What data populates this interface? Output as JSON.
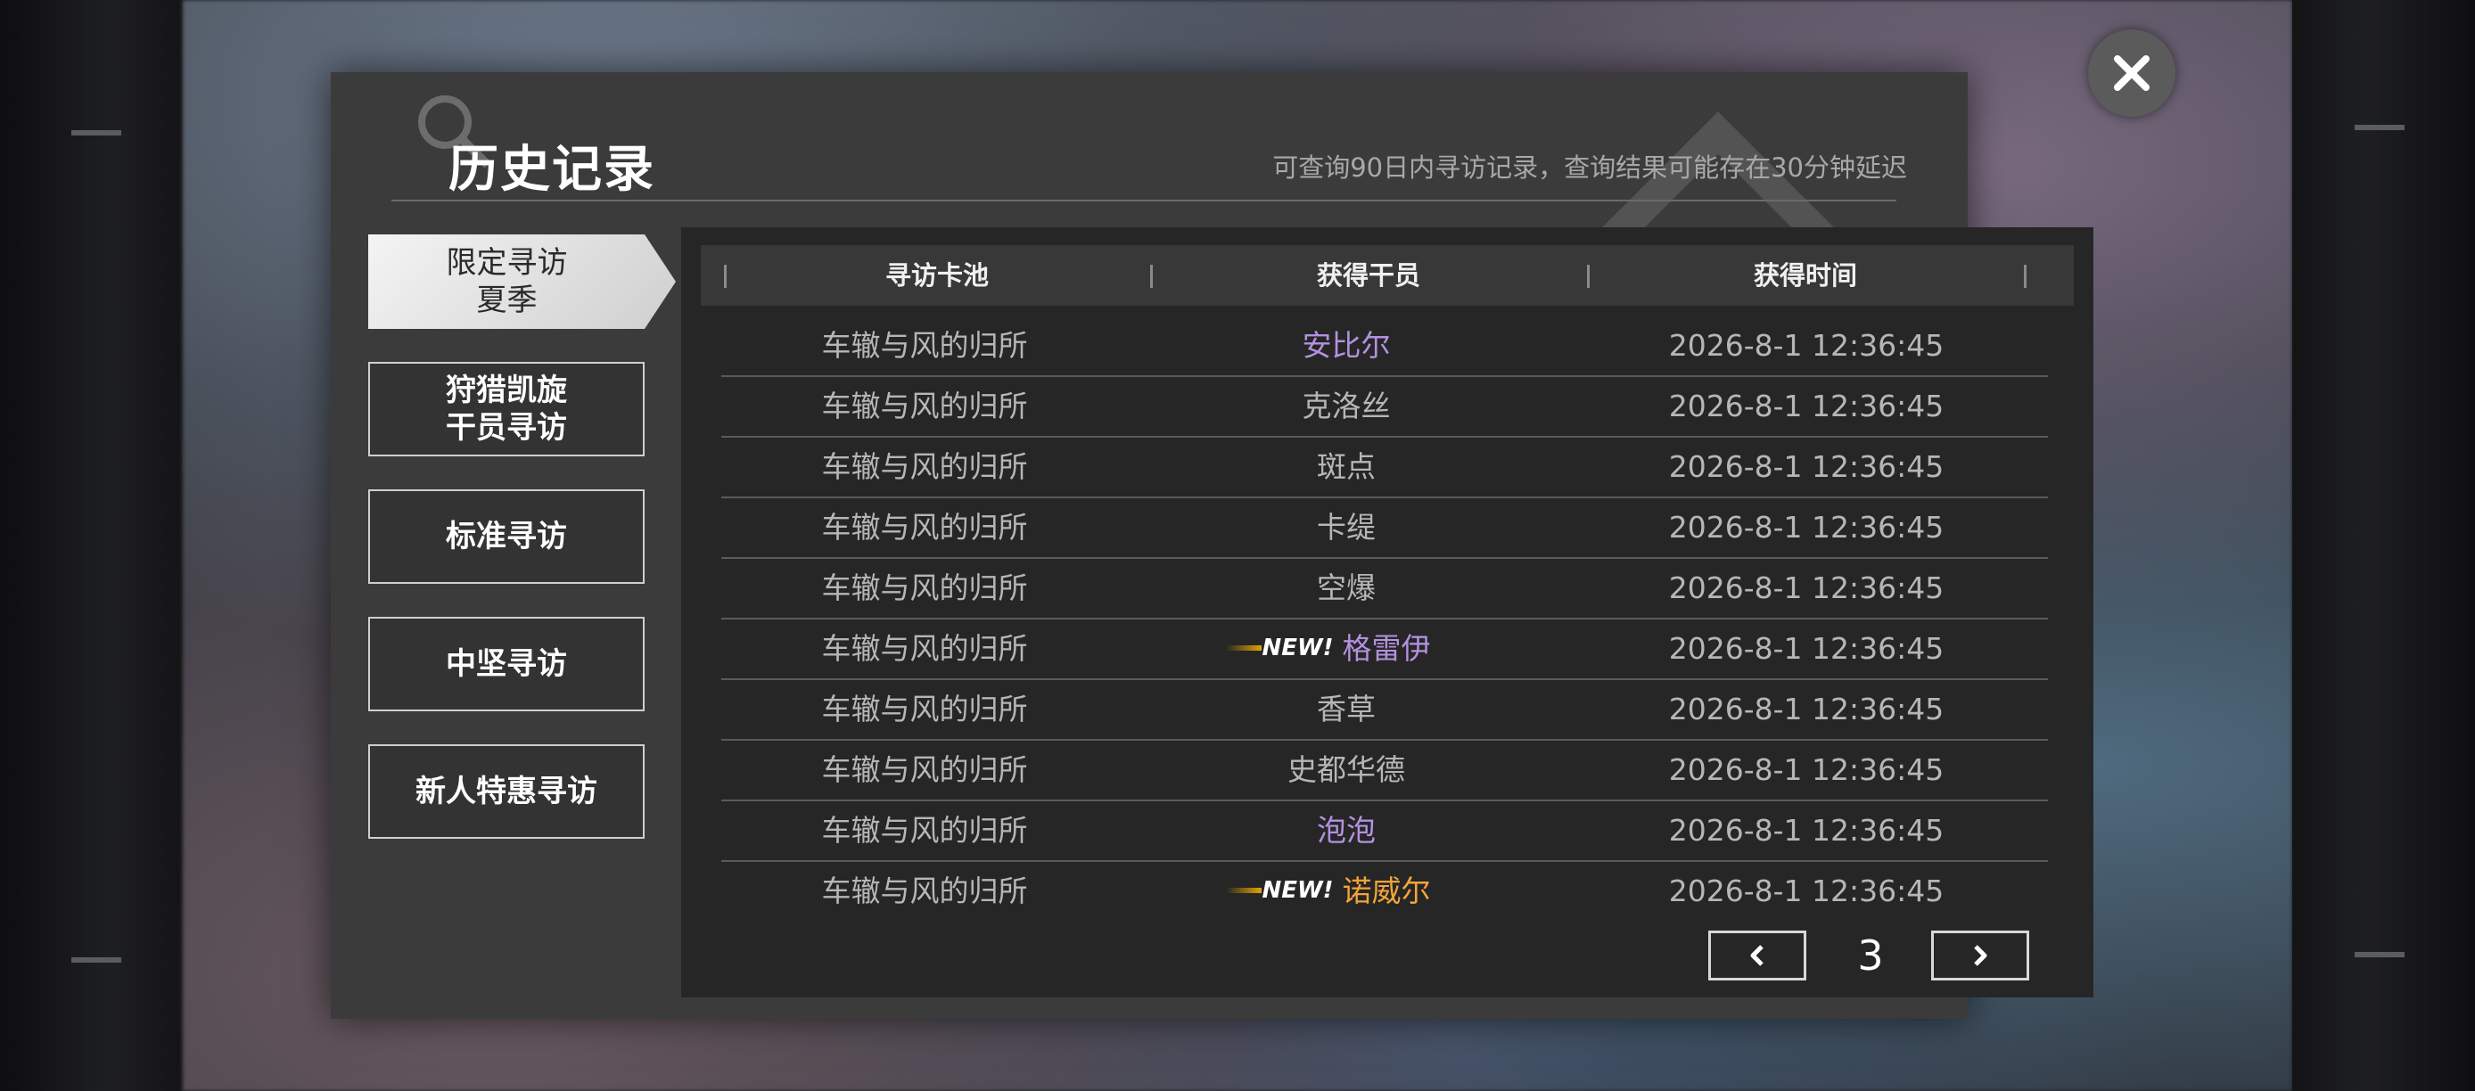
{
  "header": {
    "title": "历史记录",
    "subtitle": "可查询90日内寻访记录，查询结果可能存在30分钟延迟"
  },
  "tabs": [
    {
      "label": "限定寻访\n夏季",
      "active": true
    },
    {
      "label": "狩猎凯旋\n干员寻访",
      "active": false
    },
    {
      "label": "标准寻访",
      "active": false
    },
    {
      "label": "中坚寻访",
      "active": false
    },
    {
      "label": "新人特惠寻访",
      "active": false
    }
  ],
  "table": {
    "columns": [
      "寻访卡池",
      "获得干员",
      "获得时间"
    ],
    "rows": [
      {
        "pool": "车辙与风的归所",
        "operator": "安比尔",
        "time": "2026-8-1 12:36:45",
        "color": "purple",
        "new": false
      },
      {
        "pool": "车辙与风的归所",
        "operator": "克洛丝",
        "time": "2026-8-1 12:36:45",
        "color": "gray",
        "new": false
      },
      {
        "pool": "车辙与风的归所",
        "operator": "斑点",
        "time": "2026-8-1 12:36:45",
        "color": "gray",
        "new": false
      },
      {
        "pool": "车辙与风的归所",
        "operator": "卡缇",
        "time": "2026-8-1 12:36:45",
        "color": "gray",
        "new": false
      },
      {
        "pool": "车辙与风的归所",
        "operator": "空爆",
        "time": "2026-8-1 12:36:45",
        "color": "gray",
        "new": false
      },
      {
        "pool": "车辙与风的归所",
        "operator": "格雷伊",
        "time": "2026-8-1 12:36:45",
        "color": "purple",
        "new": true
      },
      {
        "pool": "车辙与风的归所",
        "operator": "香草",
        "time": "2026-8-1 12:36:45",
        "color": "gray",
        "new": false
      },
      {
        "pool": "车辙与风的归所",
        "operator": "史都华德",
        "time": "2026-8-1 12:36:45",
        "color": "gray",
        "new": false
      },
      {
        "pool": "车辙与风的归所",
        "operator": "泡泡",
        "time": "2026-8-1 12:36:45",
        "color": "purple",
        "new": false
      },
      {
        "pool": "车辙与风的归所",
        "operator": "诺威尔",
        "time": "2026-8-1 12:36:45",
        "color": "orange",
        "new": true
      }
    ],
    "new_badge": "NEW!"
  },
  "pagination": {
    "current_page": "3",
    "prev_icon": "chevron-left-icon",
    "next_icon": "chevron-right-icon"
  },
  "close_icon": "close-icon",
  "colors": {
    "purple": "#b491e0",
    "orange": "#f2a43a",
    "gray": "#b6b6b6"
  }
}
